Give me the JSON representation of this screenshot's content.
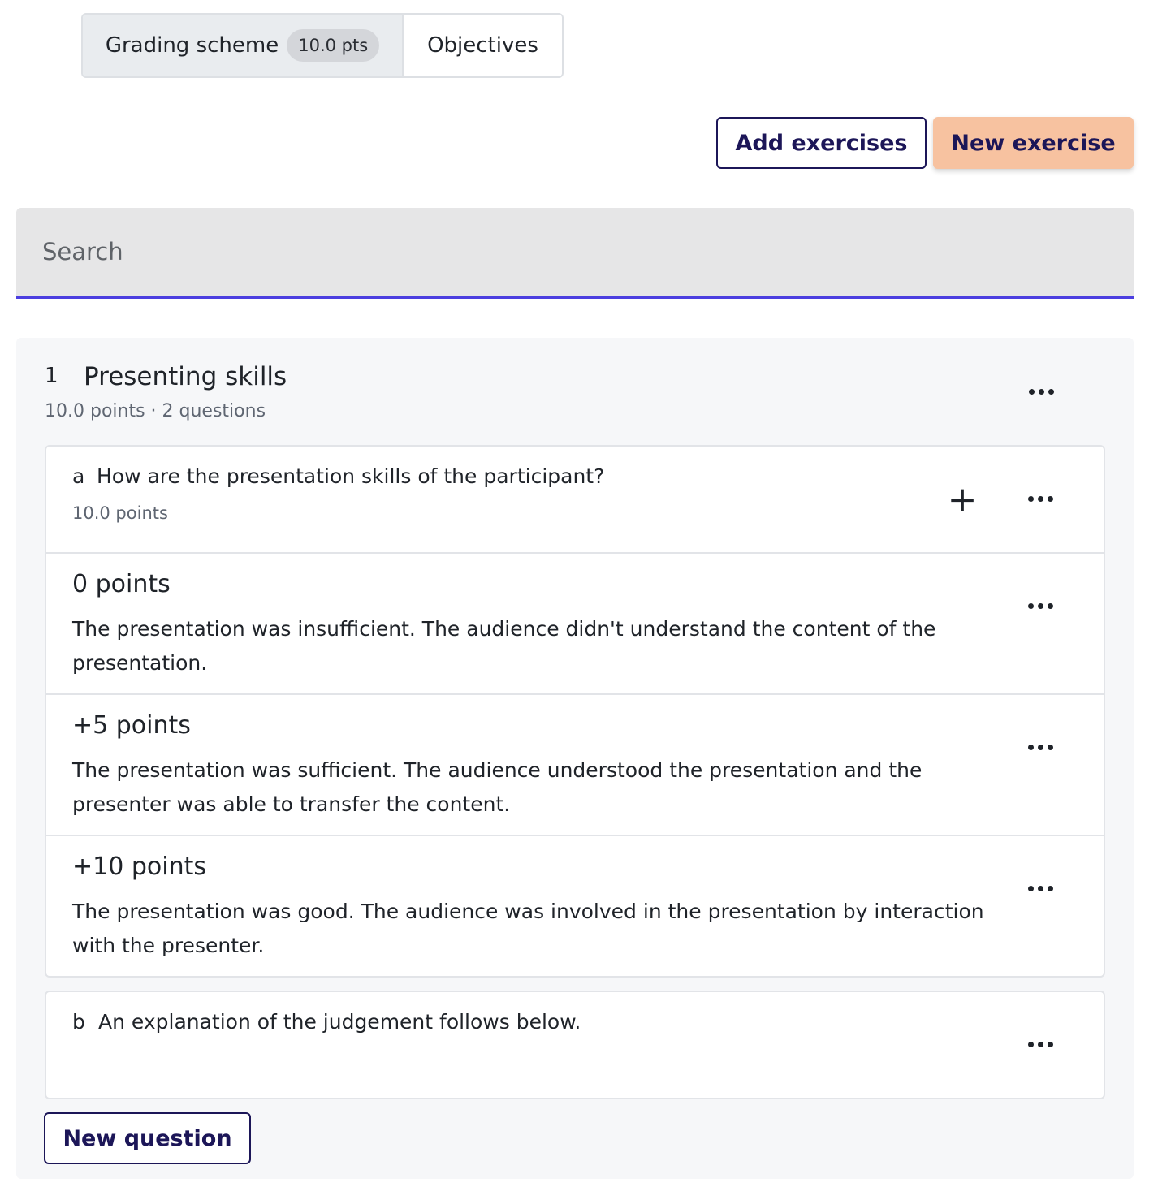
{
  "tabs": {
    "grading_label": "Grading scheme",
    "grading_badge": "10.0 pts",
    "objectives_label": "Objectives"
  },
  "actions": {
    "add_exercises": "Add exercises",
    "new_exercise": "New exercise"
  },
  "search": {
    "placeholder": "Search",
    "value": ""
  },
  "exercise": {
    "number": "1",
    "title": "Presenting skills",
    "meta": "10.0 points · 2 questions",
    "questions": [
      {
        "letter": "a",
        "text": "How are the presentation skills of the participant?",
        "points": "10.0 points",
        "levels": [
          {
            "title": "0 points",
            "description": "The presentation was insufficient. The audience didn't understand the content of the presentation."
          },
          {
            "title": "+5 points",
            "description": "The presentation was sufficient. The audience understood the presentation and the presenter was able to transfer the content."
          },
          {
            "title": "+10 points",
            "description": "The presentation was good. The audience was involved in the presentation by interaction with the presenter."
          }
        ]
      },
      {
        "letter": "b",
        "text": "An explanation of the judgement follows below."
      }
    ],
    "new_question": "New question"
  },
  "icons": {
    "more": "more-horizontal-icon",
    "plus": "plus-icon"
  },
  "colors": {
    "accent": "#4c3fe0",
    "primary_button": "#f7c2a0",
    "text_brand": "#1c1658"
  }
}
